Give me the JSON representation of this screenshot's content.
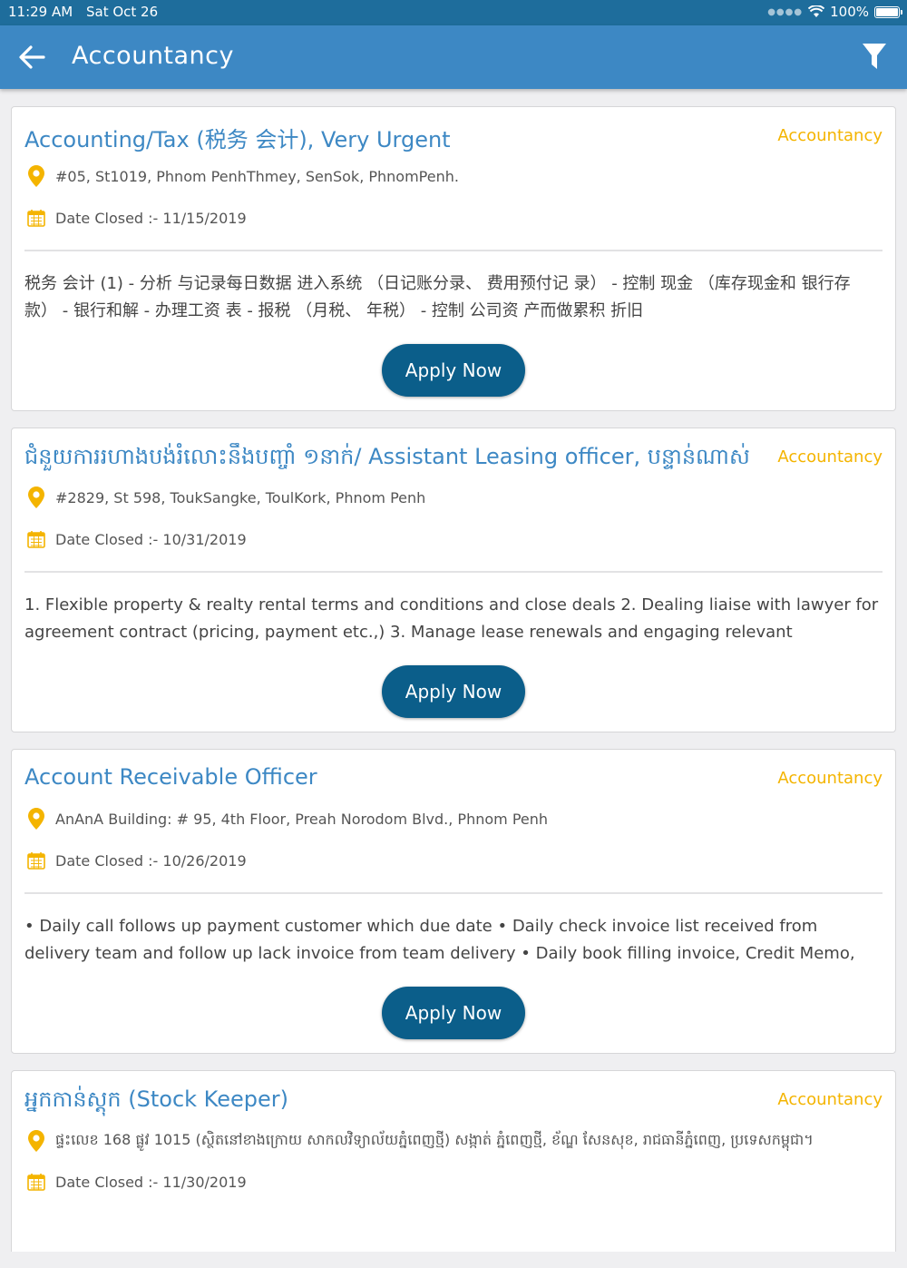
{
  "status_bar": {
    "time": "11:29 AM",
    "date": "Sat Oct 26",
    "battery": "100%",
    "battery_level": 1.0
  },
  "header": {
    "title": "Accountancy",
    "back_icon": "arrow-left-icon",
    "filter_icon": "filter-icon"
  },
  "colors": {
    "header": "#3d88c4",
    "status_bar": "#1e6d9c",
    "title": "#3d88c4",
    "category": "#f4b400",
    "button": "#0b5e8a"
  },
  "jobs": [
    {
      "title": "Accounting/Tax (税务 会计), Very Urgent",
      "category": "Accountancy",
      "location": "#05, St1019, Phnom PenhThmey, SenSok, PhnomPenh.",
      "date_closed": "Date Closed :- 11/15/2019",
      "description": "税务 会计 (1) - 分析 与记录每日数据 进入系统 （日记账分录、 费用预付记 录） - 控制 现金 （库存现金和 银行存款） - 银行和解 - 办理工资 表 - 报税 （月税、 年税） - 控制 公司资 产而做累积 折旧",
      "apply_label": "Apply Now"
    },
    {
      "title": "ជំនួយការរហាងបង់រំលោះនឹងបញ្ចាំ ១នាក់/ Assistant Leasing officer, បន្ទាន់ណាស់",
      "category": "Accountancy",
      "location": "#2829, St 598, ToukSangke, ToulKork, Phnom Penh",
      "date_closed": "Date Closed :- 10/31/2019",
      "description": "1. Flexible property & realty rental terms and conditions and close deals 2. Dealing liaise with lawyer for agreement contract (pricing, payment etc.,) 3. Manage lease renewals and engaging relevant",
      "apply_label": "Apply Now"
    },
    {
      "title": "Account Receivable Officer",
      "category": "Accountancy",
      "location": "AnAnA Building: # 95, 4th Floor, Preah Norodom Blvd., Phnom Penh",
      "date_closed": "Date Closed :- 10/26/2019",
      "description": "• Daily call follows up payment customer which due date • Daily check invoice list received from delivery team and follow up lack invoice from team delivery • Daily book filling invoice, Credit Memo, Credit",
      "apply_label": "Apply Now"
    },
    {
      "title": "អ្នកកាន់ស្តុក (Stock Keeper)",
      "category": "Accountancy",
      "location": "ផ្ទះលេខ 168 ផ្លូវ 1015 (ស្ថិតនៅខាងក្រោយ សាកលវិទ្យាល័យភ្នំពេញថ្មី) សង្កាត់ ភ្នំពេញថ្មី, ខ័ណ្ឌ សែនសុខ, រាជធានីភ្នំពេញ, ប្រទេសកម្ពុជា។",
      "date_closed": "Date Closed :- 11/30/2019"
    }
  ]
}
